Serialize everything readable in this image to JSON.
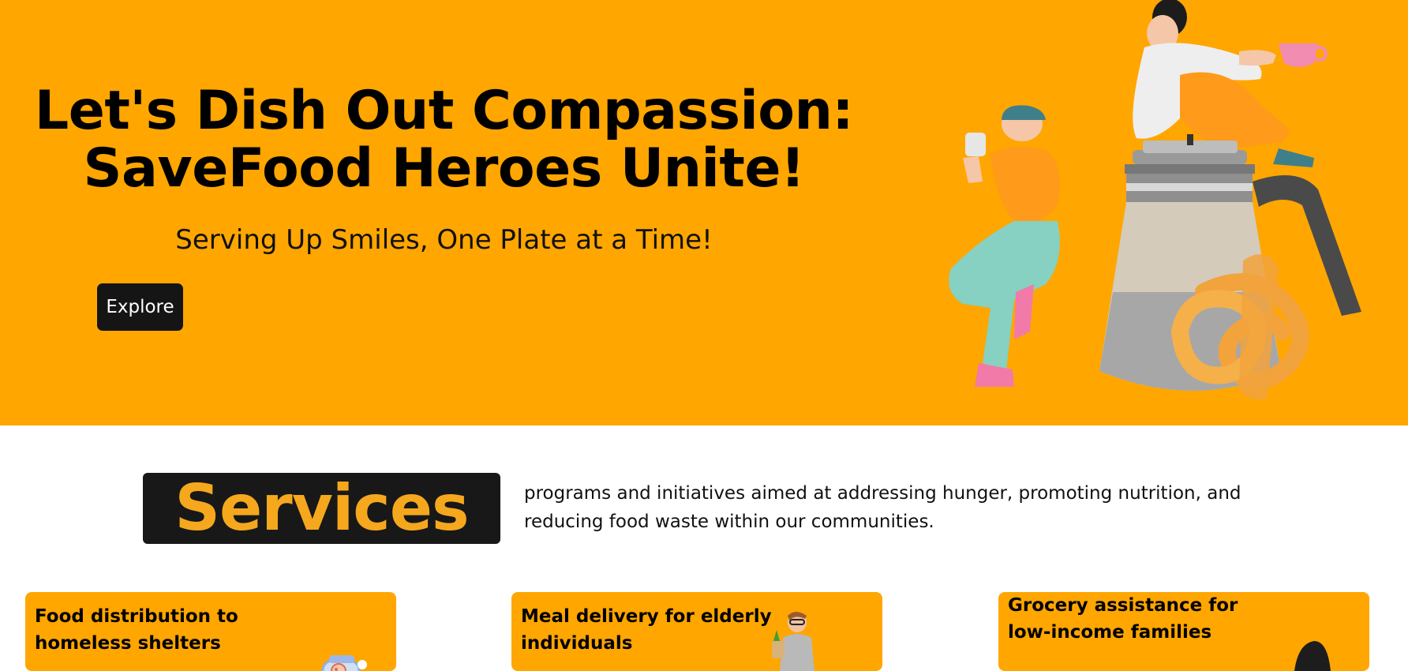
{
  "hero": {
    "title_line1": "Let's Dish Out Compassion:",
    "title_line2": "SaveFood Heroes Unite!",
    "subtitle": "Serving Up Smiles, One Plate at a Time!",
    "explore_label": "Explore",
    "illustration_icon": "people-with-coffee-pot-and-pretzel-illustration"
  },
  "services": {
    "heading": "Services",
    "description": "programs and initiatives aimed at addressing hunger, promoting nutrition, and reducing food waste within our communities."
  },
  "cards": [
    {
      "title": "Food distribution to homeless shelters",
      "icon": "food-tray-icon"
    },
    {
      "title": "Meal delivery for elderly individuals",
      "icon": "delivery-person-icon"
    },
    {
      "title": "Grocery assistance for low-income families",
      "icon": "grocery-bag-icon"
    }
  ],
  "colors": {
    "hero_background": "#FFA600",
    "accent": "#F5A81D",
    "dark": "#181818",
    "page_background": "#FFFFFF"
  }
}
